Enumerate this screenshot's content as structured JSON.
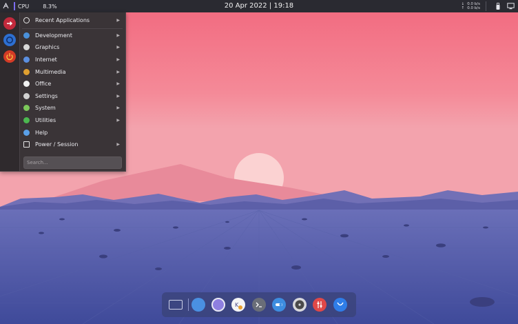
{
  "top_panel": {
    "launcher_icon": "app-launcher-icon",
    "cpu_label": "CPU",
    "cpu_value": "8.3%",
    "clock": "20 Apr 2022 | 19:18",
    "net_down_value": "0.0 b/s",
    "net_up_value": "0.0 b/s",
    "tray_icons": [
      "usb-icon",
      "display-icon"
    ]
  },
  "app_menu": {
    "side_buttons": [
      "logout-icon",
      "settings-icon",
      "power-icon"
    ],
    "items": [
      {
        "label": "Recent Applications",
        "icon": "clock-icon",
        "color": "#e8e8e8"
      },
      {
        "label": "Development",
        "icon": "development-icon",
        "color": "#4a90d9"
      },
      {
        "label": "Graphics",
        "icon": "graphics-icon",
        "color": "#d8d8d8"
      },
      {
        "label": "Internet",
        "icon": "internet-icon",
        "color": "#5b8fe0"
      },
      {
        "label": "Multimedia",
        "icon": "multimedia-icon",
        "color": "#e0a030"
      },
      {
        "label": "Office",
        "icon": "office-icon",
        "color": "#f0f0f0"
      },
      {
        "label": "Settings",
        "icon": "settings-icon",
        "color": "#d0d0d0"
      },
      {
        "label": "System",
        "icon": "system-icon",
        "color": "#7cc85a"
      },
      {
        "label": "Utilities",
        "icon": "utilities-icon",
        "color": "#4cb850"
      },
      {
        "label": "Help",
        "icon": "help-icon",
        "color": "#5aa0e8"
      },
      {
        "label": "Power / Session",
        "icon": "power-session-icon",
        "color": "#e8e8e8"
      }
    ],
    "search_placeholder": "Search..."
  },
  "dock": {
    "items": [
      {
        "name": "show-desktop-icon",
        "color": "#cfd3ea"
      },
      {
        "name": "file-manager-icon",
        "color": "#4a90e2"
      },
      {
        "name": "web-browser-icon",
        "color": "#8e7fe0"
      },
      {
        "name": "software-center-icon",
        "color": "#f4f4f6"
      },
      {
        "name": "terminal-icon",
        "color": "#6a6e78"
      },
      {
        "name": "system-settings-icon",
        "color": "#3d8de0"
      },
      {
        "name": "disk-utility-icon",
        "color": "#6b6b6b"
      },
      {
        "name": "mixer-icon",
        "color": "#e04848"
      },
      {
        "name": "app-store-icon",
        "color": "#2f7de8"
      }
    ]
  }
}
